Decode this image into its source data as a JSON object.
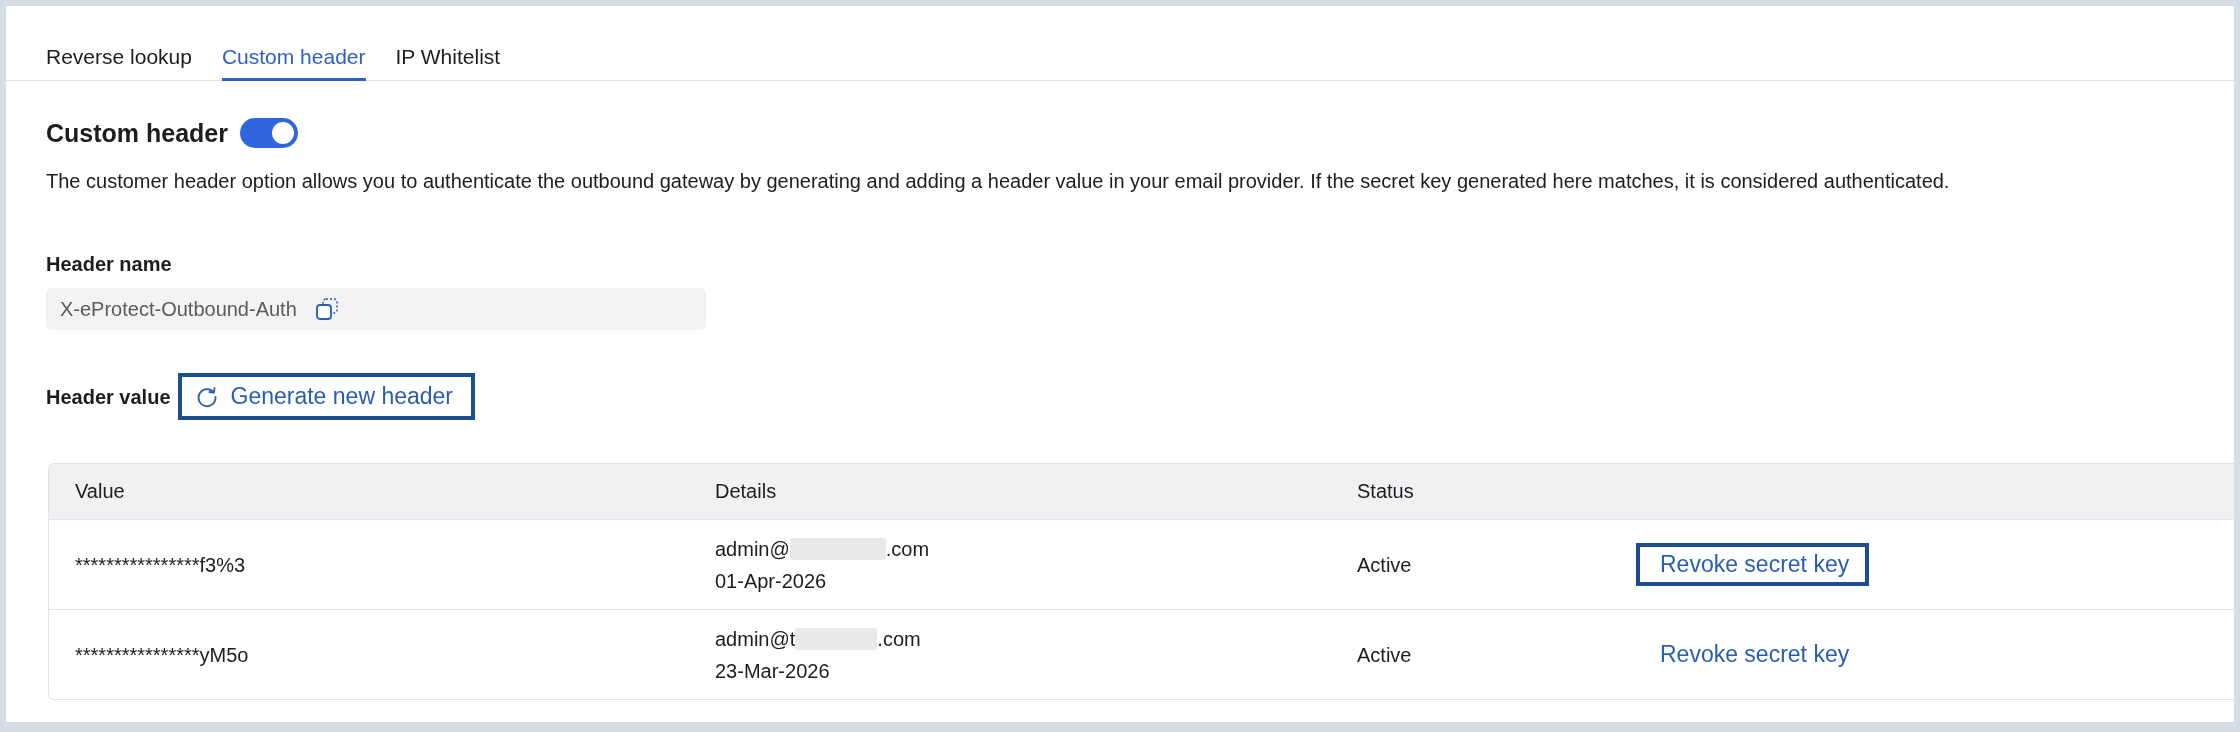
{
  "tabs": [
    {
      "label": "Reverse lookup",
      "selected": false
    },
    {
      "label": "Custom header",
      "selected": true
    },
    {
      "label": "IP Whitelist",
      "selected": false
    }
  ],
  "custom_header": {
    "title": "Custom header",
    "enabled": true,
    "description": "The customer header option allows you to authenticate the outbound gateway by generating and adding a header value in your email provider. If the secret key generated here matches, it is considered authenticated."
  },
  "header_name": {
    "label": "Header name",
    "value": "X-eProtect-Outbound-Auth"
  },
  "header_value": {
    "label": "Header value",
    "generate_button": {
      "label": "Generate new header",
      "highlighted": true
    }
  },
  "table": {
    "columns": [
      "Value",
      "Details",
      "Status"
    ],
    "rows": [
      {
        "value": "****************f3%3",
        "email_start": "admin@",
        "email_end": ".com",
        "date": "01-Apr-2026",
        "status": "Active",
        "action": {
          "label": "Revoke secret key",
          "highlighted": true
        }
      },
      {
        "value": "****************yM5o",
        "email_start": "admin@t",
        "email_end": ".com",
        "date": "23-Mar-2026",
        "status": "Active",
        "action": {
          "label": "Revoke secret key",
          "highlighted": false
        }
      }
    ]
  }
}
